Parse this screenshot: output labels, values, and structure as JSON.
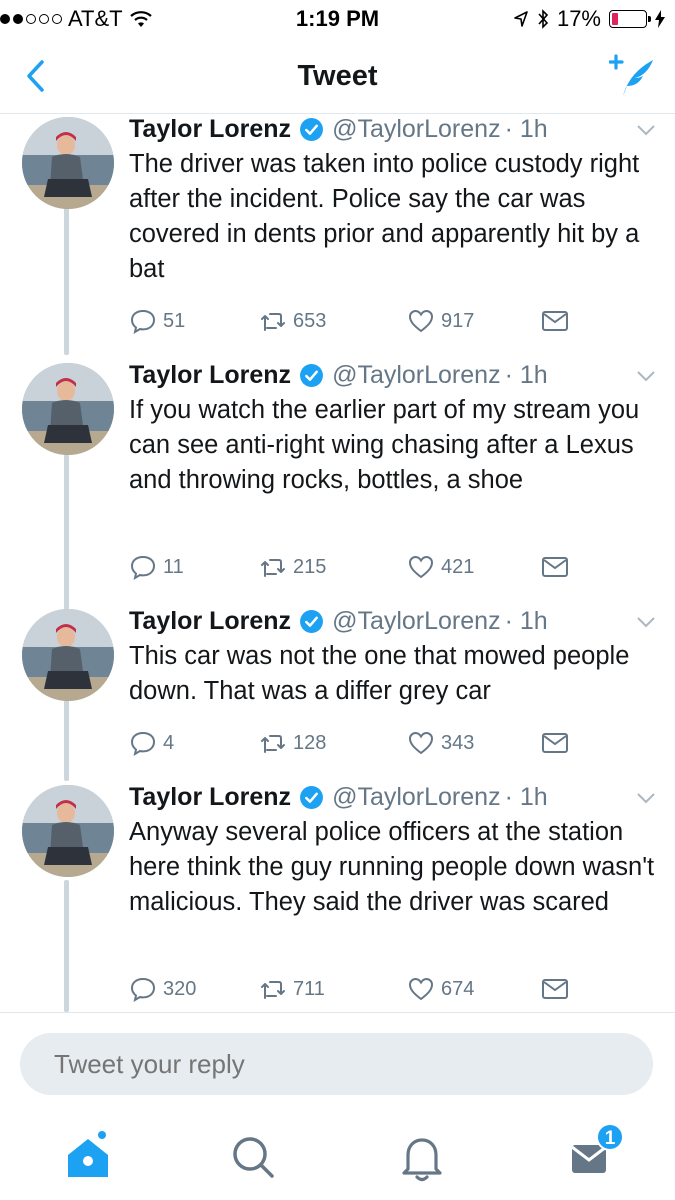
{
  "status_bar": {
    "carrier": "AT&T",
    "time": "1:19 PM",
    "battery_percent": "17%",
    "battery_color": "#e0245e",
    "icons": [
      "signal-dots-icon",
      "wifi-icon",
      "location-arrow-icon",
      "bluetooth-icon",
      "battery-icon",
      "charging-bolt-icon"
    ]
  },
  "nav": {
    "title": "Tweet",
    "back_icon": "chevron-left-icon",
    "compose_icon": "compose-tweet-icon",
    "accent": "#1da1f2"
  },
  "tweets": [
    {
      "name": "Taylor Lorenz",
      "handle": "@TaylorLorenz",
      "time": "· 1h",
      "text": "The driver was taken into police custody right after the incident. Police say the car was covered in dents prior and apparently hit by a bat",
      "replies": "51",
      "retweets": "653",
      "likes": "917"
    },
    {
      "name": "Taylor Lorenz",
      "handle": "@TaylorLorenz",
      "time": "· 1h",
      "text": "If you watch the earlier part of my stream you can see anti-right wing chasing after a Lexus and throwing rocks, bottles, a shoe",
      "replies": "11",
      "retweets": "215",
      "likes": "421"
    },
    {
      "name": "Taylor Lorenz",
      "handle": "@TaylorLorenz",
      "time": "· 1h",
      "text": "This car was not the one that mowed people down. That was a differ grey car",
      "replies": "4",
      "retweets": "128",
      "likes": "343"
    },
    {
      "name": "Taylor Lorenz",
      "handle": "@TaylorLorenz",
      "time": "· 1h",
      "text": "Anyway several police officers at the station here think the guy running people down wasn't malicious. They said the driver was scared",
      "replies": "320",
      "retweets": "711",
      "likes": "674"
    }
  ],
  "reply": {
    "placeholder": "Tweet your reply"
  },
  "tab_bar": {
    "tabs": [
      "home-icon",
      "search-icon",
      "notifications-bell-icon",
      "messages-envelope-icon"
    ],
    "messages_badge": "1",
    "active_color": "#1da1f2",
    "inactive_color": "#657786"
  }
}
